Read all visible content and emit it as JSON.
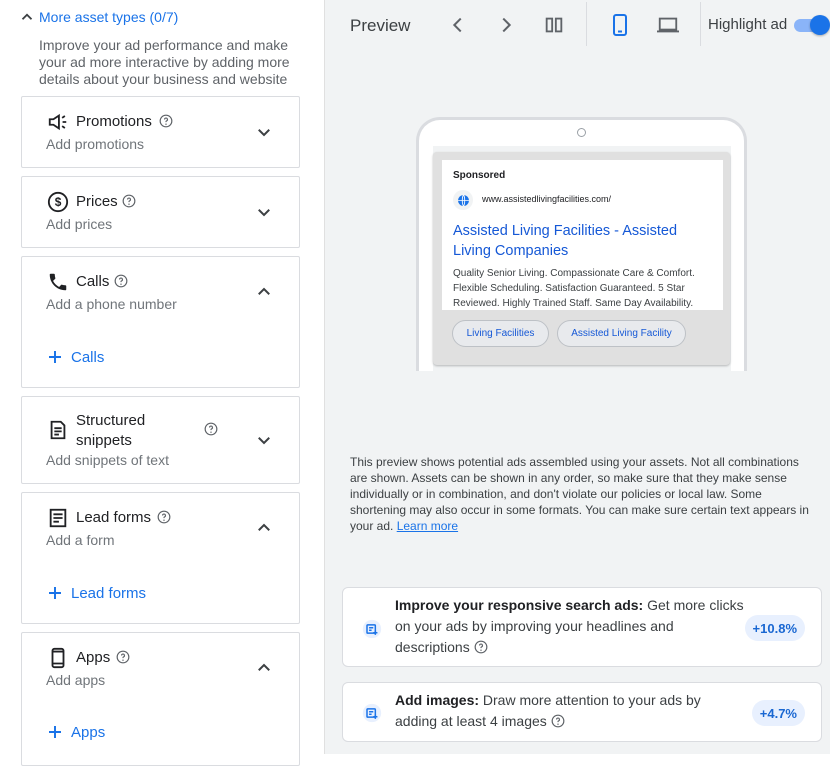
{
  "left_panel": {
    "section_title": "More asset types (0/7)",
    "section_description": "Improve your ad performance and make your ad more interactive by adding more details about your business and website",
    "cards": [
      {
        "title": "Promotions",
        "subtitle": "Add promotions",
        "icon": "megaphone-icon",
        "expanded": false
      },
      {
        "title": "Prices",
        "subtitle": "Add prices",
        "icon": "dollar-icon",
        "expanded": false
      },
      {
        "title": "Calls",
        "subtitle": "Add a phone number",
        "icon": "phone-icon",
        "expanded": true,
        "add_label": "Calls"
      },
      {
        "title": "Structured snippets",
        "subtitle": "Add snippets of text",
        "icon": "document-icon",
        "expanded": false
      },
      {
        "title": "Lead forms",
        "subtitle": "Add a form",
        "icon": "form-icon",
        "expanded": true,
        "add_label": "Lead forms"
      },
      {
        "title": "Apps",
        "subtitle": "Add apps",
        "icon": "smartphone-icon",
        "expanded": true,
        "add_label": "Apps"
      }
    ]
  },
  "preview": {
    "title": "Preview",
    "highlight_label": "Highlight ad",
    "highlight_on": true,
    "ad": {
      "sponsored": "Sponsored",
      "url": "www.assistedlivingfacilities.com/",
      "headline": "Assisted Living Facilities - Assisted Living Companies",
      "description": "Quality Senior Living. Compassionate Care & Comfort. Flexible Scheduling. Satisfaction Guaranteed. 5 Star Reviewed. Highly Trained Staff. Same Day Availability.",
      "sitelinks": [
        "Living Facilities",
        "Assisted Living Facility"
      ]
    },
    "disclaimer": "This preview shows potential ads assembled using your assets. Not all combinations are shown. Assets can be shown in any order, so make sure that they make sense individually or in combination, and don't violate our policies or local law. Some shortening may also occur in some formats. You can make sure certain text appears in your ad.",
    "learn_more": "Learn more"
  },
  "tips": [
    {
      "bold": "Improve your responsive search ads:",
      "text": "Get more clicks on your ads by improving your headlines and descriptions",
      "badge": "+10.8%"
    },
    {
      "bold": "Add images:",
      "text": "Draw more attention to your ads by adding at least 4 images",
      "badge": "+4.7%"
    }
  ],
  "colors": {
    "accent": "#1a73e8",
    "toggle_track": "#8ab4f8",
    "badge_bg": "#e8f0fe"
  }
}
